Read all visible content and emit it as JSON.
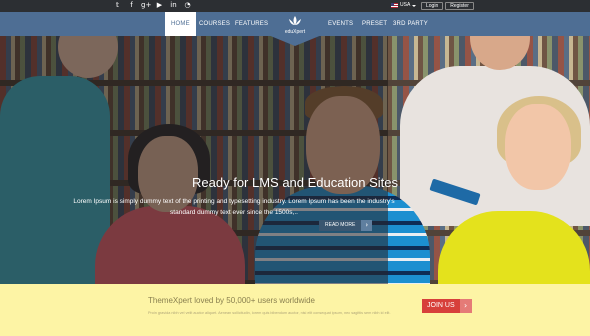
{
  "topbar": {
    "social_icons": [
      {
        "name": "twitter-icon",
        "glyph": "𝕥"
      },
      {
        "name": "facebook-icon",
        "glyph": "f"
      },
      {
        "name": "google-plus-icon",
        "glyph": "g+"
      },
      {
        "name": "youtube-icon",
        "glyph": "▶"
      },
      {
        "name": "linkedin-icon",
        "glyph": "in"
      },
      {
        "name": "rss-icon",
        "glyph": "◔"
      }
    ],
    "language": "USA",
    "login_label": "Login",
    "register_label": "Register"
  },
  "nav": {
    "items": [
      "HOME",
      "COURSES",
      "FEATURES",
      "EVENTS",
      "PRESET",
      "3RD PARTY"
    ],
    "active": "HOME",
    "logo_text": "eduXpert",
    "color": "#4e6e94"
  },
  "hero": {
    "title": "Ready for LMS and Education Sites",
    "text": "Lorem Ipsum is simply dummy text of the printing and typesetting industry. Lorem Ipsum has been the industry's standard dummy text ever since the 1500s,..",
    "button_label": "READ MORE",
    "button_icon": "chevron-right-icon"
  },
  "promo": {
    "title": "ThemeXpert loved by 50,000+ users worldwide",
    "text": "Proin gravida nibh vel velit auctor aliquet. Aenean sollicitudin, lorem quis bibendum auctor, nisi elit consequat ipsum, nec sagittis sem nibh id elit.",
    "button_label": "JOIN US",
    "background": "#fdf4a5",
    "button_color": "#d7403b"
  }
}
